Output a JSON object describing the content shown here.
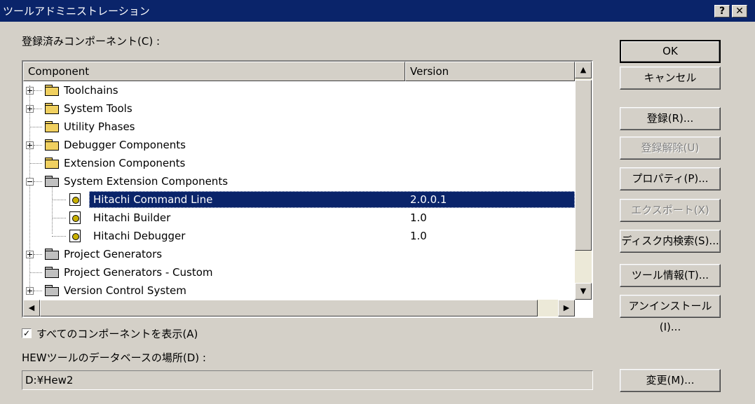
{
  "window": {
    "title": "ツールアドミニストレーション",
    "help_label": "?",
    "close_label": "✕"
  },
  "registered_label": "登録済みコンポーネント(C) :",
  "list": {
    "columns": [
      "Component",
      "Version"
    ],
    "rows": [
      {
        "name": "Toolchains",
        "version": "",
        "expander": "plus"
      },
      {
        "name": "System Tools",
        "version": "",
        "expander": "plus"
      },
      {
        "name": "Utility Phases",
        "version": "",
        "expander": "none"
      },
      {
        "name": "Debugger Components",
        "version": "",
        "expander": "plus"
      },
      {
        "name": "Extension Components",
        "version": "",
        "expander": "none"
      },
      {
        "name": "System Extension Components",
        "version": "",
        "expander": "minus"
      },
      {
        "name": "Hitachi Command Line",
        "version": "2.0.0.1",
        "selected": true
      },
      {
        "name": "Hitachi Builder",
        "version": "1.0"
      },
      {
        "name": "Hitachi Debugger",
        "version": "1.0"
      },
      {
        "name": "Project Generators",
        "version": "",
        "expander": "plus"
      },
      {
        "name": "Project Generators - Custom",
        "version": "",
        "expander": "none"
      },
      {
        "name": "Version Control System",
        "version": "",
        "expander": "plus"
      }
    ]
  },
  "buttons": {
    "ok": "OK",
    "cancel": "キャンセル",
    "register": "登録(R)...",
    "unregister": "登録解除(U)",
    "properties": "プロパティ(P)...",
    "export": "エクスポート(X)",
    "search_disk": "ディスク内検索(S)...",
    "tool_info": "ツール情報(T)...",
    "uninstall": "アンインストール(I)...",
    "change": "変更(M)..."
  },
  "show_all": {
    "label": "すべてのコンポーネントを表示(A)",
    "checked": true,
    "mark": "✓"
  },
  "db_location": {
    "label": "HEWツールのデータベースの場所(D) :",
    "value": "D:¥Hew2"
  }
}
